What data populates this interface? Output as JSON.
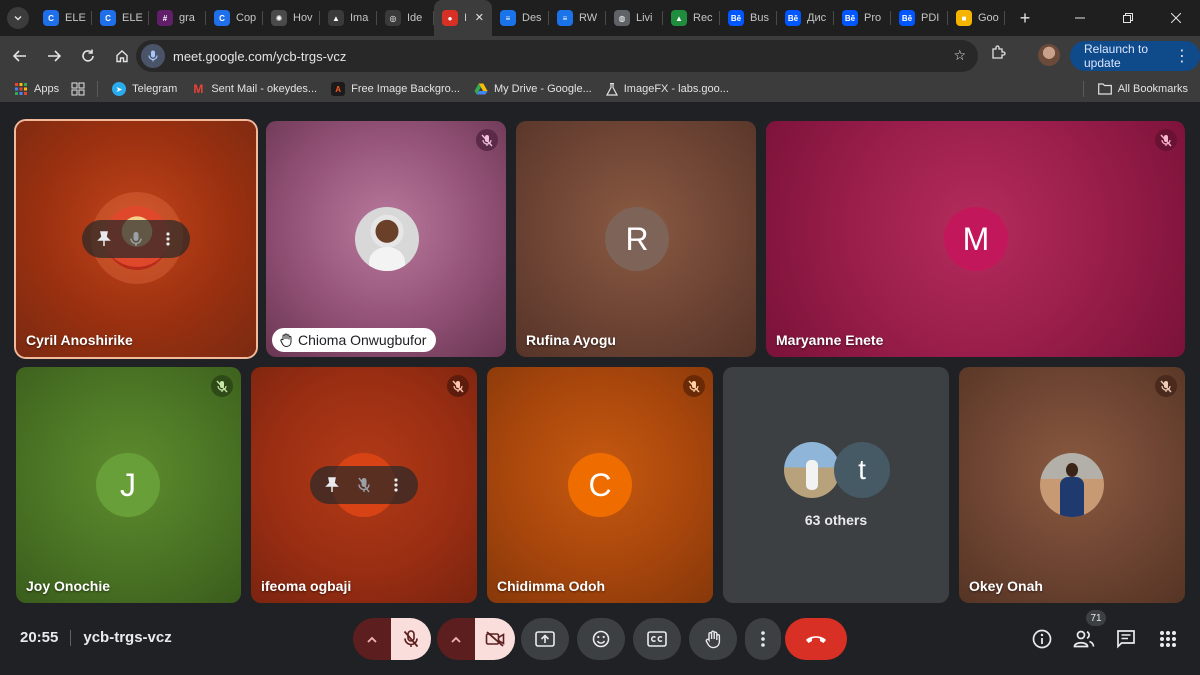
{
  "browser": {
    "tabs": [
      {
        "title": "ELE",
        "favicon": "C",
        "color": "#1f6feb",
        "active": false
      },
      {
        "title": "ELE",
        "favicon": "C",
        "color": "#1f6feb",
        "active": false
      },
      {
        "title": "gra",
        "favicon": "#",
        "color": "#611f69",
        "active": false
      },
      {
        "title": "Cop",
        "favicon": "C",
        "color": "#1f6feb",
        "active": false
      },
      {
        "title": "Hov",
        "favicon": "✺",
        "color": "#4a4a4a",
        "active": false
      },
      {
        "title": "Ima",
        "favicon": "▲",
        "color": "#3a3a3a",
        "active": false
      },
      {
        "title": "Ide",
        "favicon": "◎",
        "color": "#3a3a3a",
        "active": false
      },
      {
        "title": "I",
        "favicon": "●",
        "color": "#d93025",
        "active": true
      },
      {
        "title": "Des",
        "favicon": "≡",
        "color": "#1a73e8",
        "active": false
      },
      {
        "title": "RW",
        "favicon": "≡",
        "color": "#1a73e8",
        "active": false
      },
      {
        "title": "Livi",
        "favicon": "◍",
        "color": "#5f6368",
        "active": false
      },
      {
        "title": "Rec",
        "favicon": "▲",
        "color": "#1e8e3e",
        "active": false
      },
      {
        "title": "Bus",
        "favicon": "Bē",
        "color": "#0057ff",
        "active": false
      },
      {
        "title": "Дис",
        "favicon": "Bē",
        "color": "#0057ff",
        "active": false
      },
      {
        "title": "Pro",
        "favicon": "Bē",
        "color": "#0057ff",
        "active": false
      },
      {
        "title": "PDI",
        "favicon": "Bē",
        "color": "#0057ff",
        "active": false
      },
      {
        "title": "Goo",
        "favicon": "■",
        "color": "#f4b400",
        "active": false
      }
    ],
    "url": "meet.google.com/ycb-trgs-vcz",
    "relaunch_label": "Relaunch to update",
    "bookmarks": [
      {
        "label": "Apps",
        "icon": "apps-grid-icon"
      },
      {
        "label": "Telegram",
        "icon": "telegram-icon"
      },
      {
        "label": "Sent Mail - okeydes...",
        "icon": "gmail-icon"
      },
      {
        "label": "Free Image Backgro...",
        "icon": "adobe-icon"
      },
      {
        "label": "My Drive - Google...",
        "icon": "drive-icon"
      },
      {
        "label": "ImageFX - labs.goo...",
        "icon": "labs-icon"
      }
    ],
    "all_bookmarks_label": "All Bookmarks"
  },
  "meet": {
    "tiles": [
      {
        "name": "Cyril Anoshirike",
        "kind": "photo-hover",
        "muted": false,
        "active_speaker": true
      },
      {
        "name": "Chioma Onwugbufor",
        "kind": "photo",
        "muted": true,
        "hand_raised": true
      },
      {
        "name": "Rufina Ayogu",
        "kind": "letter",
        "letter": "R",
        "muted": false
      },
      {
        "name": "Maryanne Enete",
        "kind": "letter",
        "letter": "M",
        "muted": true
      },
      {
        "name": "Joy Onochie",
        "kind": "letter",
        "letter": "J",
        "muted": true
      },
      {
        "name": "ifeoma ogbaji",
        "kind": "hover",
        "muted": true
      },
      {
        "name": "Chidimma Odoh",
        "kind": "letter",
        "letter": "C",
        "muted": true
      },
      {
        "name": "63 others",
        "kind": "others",
        "letter": "t"
      },
      {
        "name": "Okey Onah",
        "kind": "photo",
        "muted": true
      }
    ],
    "time": "20:55",
    "meeting_code": "ycb-trgs-vcz",
    "participant_count": "71"
  }
}
